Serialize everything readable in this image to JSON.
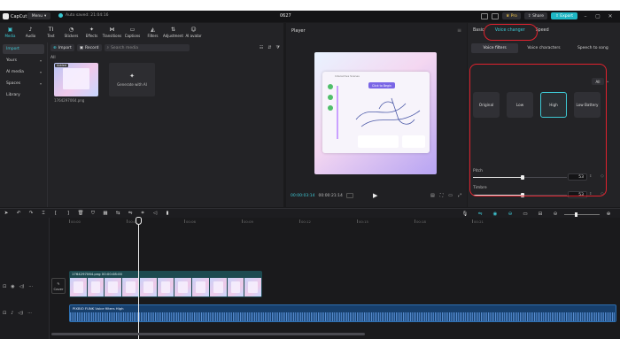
{
  "topbar": {
    "app_name": "CapCut",
    "menu_label": "Menu",
    "autosave": "Auto saved: 21:04:16",
    "project_title": "0627",
    "pro_label": "Pro",
    "share_label": "Share",
    "export_label": "Export"
  },
  "media_tools": [
    {
      "icon": "media-icon",
      "label": "Media",
      "glyph": "▣"
    },
    {
      "icon": "audio-icon",
      "label": "Audio",
      "glyph": "♪"
    },
    {
      "icon": "text-icon",
      "label": "Text",
      "glyph": "TI"
    },
    {
      "icon": "stickers-icon",
      "label": "Stickers",
      "glyph": "◔"
    },
    {
      "icon": "effects-icon",
      "label": "Effects",
      "glyph": "✦"
    },
    {
      "icon": "transitions-icon",
      "label": "Transitions",
      "glyph": "⋈"
    },
    {
      "icon": "captions-icon",
      "label": "Captions",
      "glyph": "▭"
    },
    {
      "icon": "filters-icon",
      "label": "Filters",
      "glyph": "◭"
    },
    {
      "icon": "adjustment-icon",
      "label": "Adjustment",
      "glyph": "⇅"
    },
    {
      "icon": "ai-avatar-icon",
      "label": "AI avatar",
      "glyph": "☺"
    }
  ],
  "sidebar": {
    "items": [
      {
        "label": "Import"
      },
      {
        "label": "Yours"
      },
      {
        "label": "AI media"
      },
      {
        "label": "Spaces"
      },
      {
        "label": "Library"
      }
    ]
  },
  "media": {
    "import_label": "Import",
    "record_label": "Record",
    "search_placeholder": "Search media",
    "all_label": "All",
    "thumb_badge": "Added",
    "thumb_name": "1764297064.png",
    "ai_card_label": "Generate with AI"
  },
  "player": {
    "title": "Player",
    "time_current": "00:00:03:14",
    "time_total": "00:00:21:14",
    "preview_heading": "Interactive Scenes",
    "preview_button": "Click to Begin"
  },
  "right_panel": {
    "tabs": [
      {
        "label": "Basic"
      },
      {
        "label": "Voice changer"
      },
      {
        "label": "Speed"
      }
    ],
    "subtabs": [
      {
        "label": "Voice filters"
      },
      {
        "label": "Voice characters"
      },
      {
        "label": "Speech to song"
      }
    ],
    "all_chip": "All",
    "filters": [
      {
        "label": "Original"
      },
      {
        "label": "Low"
      },
      {
        "label": "High"
      },
      {
        "label": "Low Battery"
      }
    ],
    "pitch": {
      "label": "Pitch",
      "value": "53",
      "level": 0.53
    },
    "timbre": {
      "label": "Timbre",
      "value": "53",
      "level": 0.53
    }
  },
  "timeline": {
    "ruler": [
      "00:00",
      "00:03",
      "00:06",
      "00:09",
      "00:12",
      "00:15",
      "00:18",
      "00:21"
    ],
    "cover_label": "Cover",
    "video_clip_label": "1764297064.png  00:00:08:00",
    "audio_clip_label": "PIXBIO FUNK  Voice filters High",
    "playhead_seconds": 3.5
  },
  "colors": {
    "accent": "#3ec8d4",
    "annotation": "#e0222e",
    "video_clip": "#1d4a50",
    "audio_clip": "#173f6c",
    "pro": "#f0c64a"
  }
}
